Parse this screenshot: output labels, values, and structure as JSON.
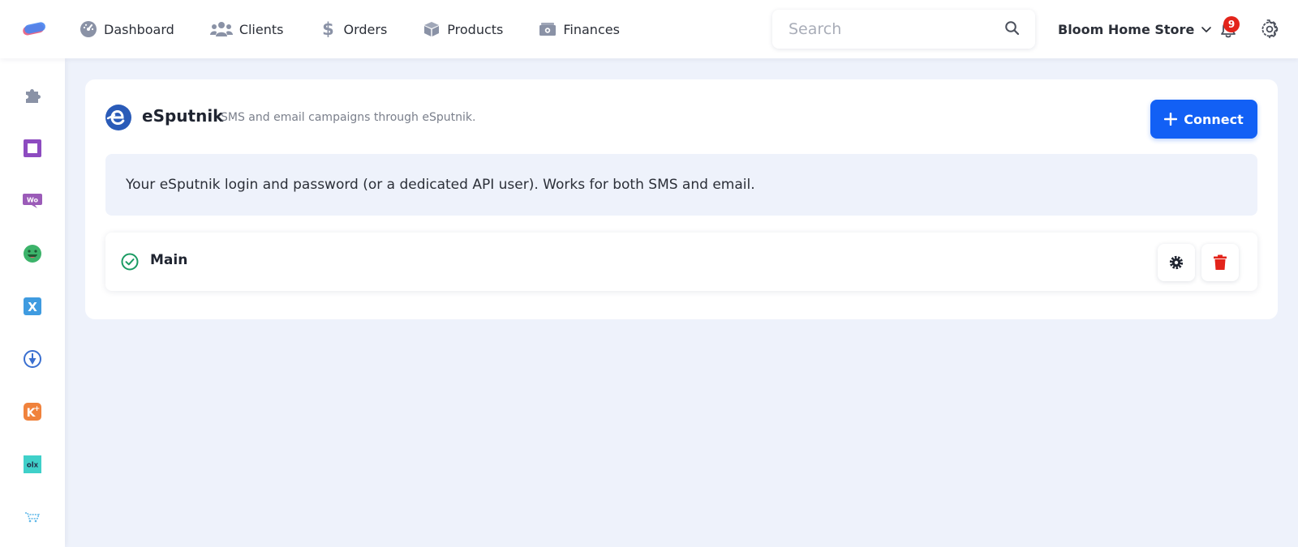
{
  "topbar": {
    "nav": [
      {
        "label": "Dashboard",
        "icon": "gauge-icon"
      },
      {
        "label": "Clients",
        "icon": "users-icon"
      },
      {
        "label": "Orders",
        "icon": "dollar-icon"
      },
      {
        "label": "Products",
        "icon": "box-icon"
      },
      {
        "label": "Finances",
        "icon": "money-icon"
      }
    ],
    "search": {
      "placeholder": "Search",
      "value": ""
    },
    "store_name": "Bloom Home Store",
    "notifications_count": "9"
  },
  "sidebar": {
    "items": [
      {
        "icon": "puzzle-icon"
      },
      {
        "icon": "square-app-icon"
      },
      {
        "icon": "woocommerce-icon"
      },
      {
        "icon": "smile-app-icon"
      },
      {
        "icon": "x-app-icon"
      },
      {
        "icon": "location-app-icon"
      },
      {
        "icon": "k-plus-app-icon"
      },
      {
        "icon": "olx-icon"
      },
      {
        "icon": "cart-app-icon"
      }
    ]
  },
  "integration": {
    "name": "eSputnik",
    "description": "SMS and email campaigns through eSputnik.",
    "connect_label": "Connect",
    "info_text": "Your eSputnik login and password (or a dedicated API user). Works for both SMS and email.",
    "accounts": [
      {
        "name": "Main",
        "status": "connected"
      }
    ]
  },
  "colors": {
    "accent": "#1260f5",
    "page_bg": "#eef2fb",
    "success": "#1a9b63",
    "danger": "#e3241b"
  }
}
